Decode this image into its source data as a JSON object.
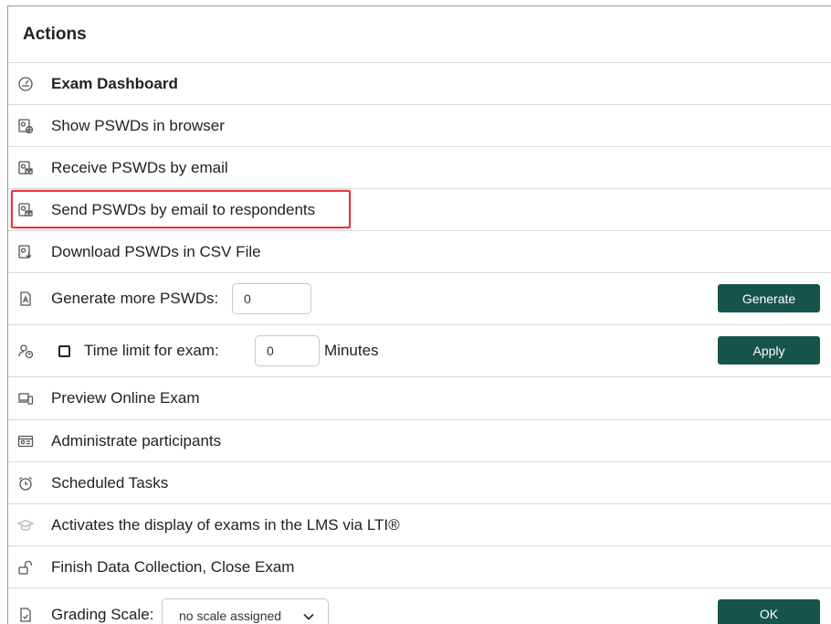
{
  "header": {
    "title": "Actions"
  },
  "actions": {
    "exam_dashboard": "Exam Dashboard",
    "show_pswds_browser": "Show PSWDs in browser",
    "receive_pswds_email": "Receive PSWDs by email",
    "send_pswds_respondents": "Send PSWDs by email to respondents",
    "download_pswds_csv": "Download PSWDs in CSV File",
    "generate_more_label": "Generate more PSWDs:",
    "generate_count": "0",
    "generate_button": "Generate",
    "time_limit_label": "Time limit for exam:",
    "time_limit_value": "0",
    "minutes_label": "Minutes",
    "apply_button": "Apply",
    "time_limit_checked": false,
    "preview_online_exam": "Preview Online Exam",
    "administrate_participants": "Administrate participants",
    "scheduled_tasks": "Scheduled Tasks",
    "activate_lms_display": "Activates the display of exams in the LMS via LTI®",
    "finish_data_collection": "Finish Data Collection, Close Exam",
    "grading_scale_label": "Grading Scale:",
    "grading_scale_value": "no scale assigned",
    "ok_button": "OK"
  },
  "colors": {
    "button_bg": "#17544a",
    "highlight_border": "#e0393e"
  }
}
